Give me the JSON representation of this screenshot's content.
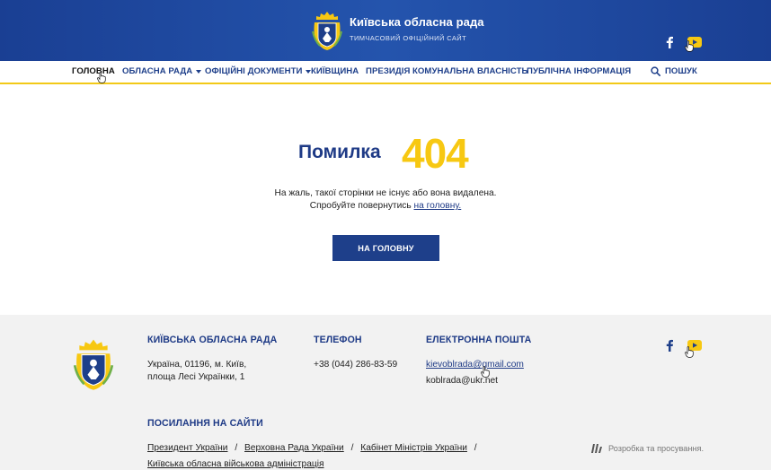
{
  "header": {
    "title": "Київська обласна рада",
    "subtitle": "ТИМЧАСОВИЙ ОФІЦІЙНИЙ САЙТ"
  },
  "nav": {
    "items": [
      {
        "label": "ГОЛОВНА"
      },
      {
        "label": "ОБЛАСНА РАДА"
      },
      {
        "label": "ОФІЦІЙНІ ДОКУМЕНТИ"
      },
      {
        "label": "КИЇВЩИНА"
      },
      {
        "label": "ПРЕЗИДІЯ"
      },
      {
        "label": "КОМУНАЛЬНА ВЛАСНІСТЬ"
      },
      {
        "label": "ПУБЛІЧНА ІНФОРМАЦІЯ"
      }
    ],
    "search_label": "ПОШУК"
  },
  "error": {
    "title": "Помилка",
    "code": "404",
    "message_line1": "На жаль, такої сторінки не існує або вона видалена.",
    "message_line2_prefix": "Спробуйте повернутись",
    "message_link": "на головну.",
    "button_label": "НА ГОЛОВНУ"
  },
  "footer": {
    "org_heading": "КИЇВСЬКА ОБЛАСНА РАДА",
    "address_line1": "Україна, 01196, м. Київ,",
    "address_line2": "площа Лесі Українки, 1",
    "phone_heading": "ТЕЛЕФОН",
    "phone": "+38 (044) 286-83-59",
    "email_heading": "ЕЛЕКТРОННА ПОШТА",
    "email1": "kievoblrada@gmail.com",
    "email2": "koblrada@ukr.net",
    "links_heading": "ПОСИЛАННЯ НА САЙТИ",
    "links": [
      "Президент України",
      "Верховна Рада України",
      "Кабінет Міністрів України",
      "Київська обласна військова адміністрація"
    ],
    "separator": "/",
    "developer_text": "Розробка та просування."
  },
  "colors": {
    "brand_blue": "#1e3f8a",
    "accent_yellow": "#f7c812",
    "footer_bg": "#f2f2f2"
  },
  "icons": {
    "facebook": "facebook-icon",
    "youtube": "youtube-icon",
    "search": "search-icon",
    "crest": "kyiv-oblast-crest-icon",
    "developer": "developer-logo-icon",
    "cursor": "hand-cursor-icon"
  }
}
